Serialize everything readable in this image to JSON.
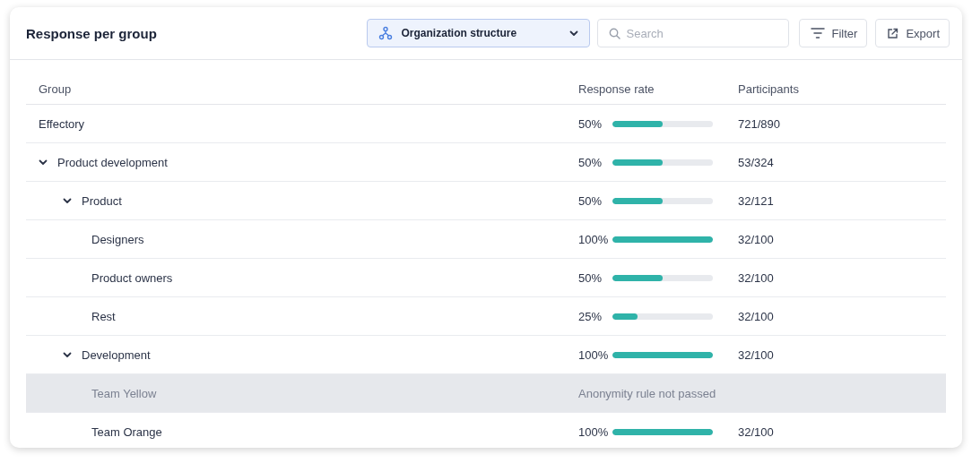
{
  "header": {
    "title": "Response per group",
    "structure_dropdown": {
      "value": "Organization structure"
    },
    "search": {
      "placeholder": "Search"
    },
    "buttons": [
      "Filter",
      "Export"
    ]
  },
  "table": {
    "columns": [
      "Group",
      "Response rate",
      "Participants"
    ],
    "rows": [
      {
        "name": "Effectory",
        "rate": "50%",
        "level": 0.5,
        "participants": "721/890"
      },
      {
        "name": "Product development",
        "expanded": true,
        "rate": "50%",
        "level": 0.5,
        "participants": "53/324",
        "children": [
          {
            "name": "Product",
            "expanded": true,
            "rate": "50%",
            "level": 0.5,
            "participants": "32/121",
            "children": [
              {
                "name": "Designers",
                "rate": "100%",
                "level": 1,
                "participants": "32/100"
              },
              {
                "name": "Product owners",
                "rate": "50%",
                "level": 0.5,
                "participants": "32/100"
              },
              {
                "name": "Rest",
                "rate": "25%",
                "level": 0.25,
                "participants": "32/100"
              }
            ]
          },
          {
            "name": "Development",
            "expanded": true,
            "rate": "100%",
            "level": 1,
            "participants": "32/100",
            "children": [
              {
                "name": "Team Yellow",
                "disabled": true,
                "note": "Anonymity rule not passed"
              },
              {
                "name": "Team Orange",
                "disabled": false,
                "rate": "100%",
                "level": 1,
                "participants": "32/100"
              }
            ]
          }
        ]
      }
    ]
  }
}
